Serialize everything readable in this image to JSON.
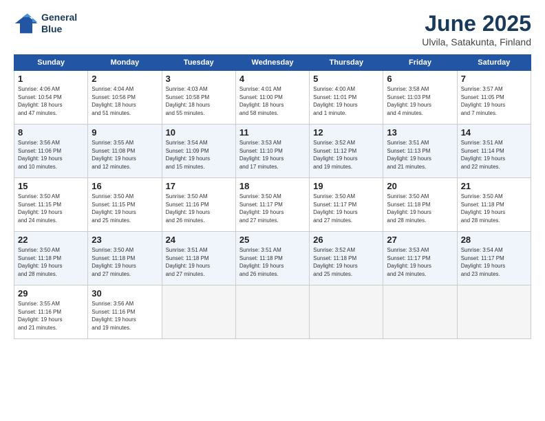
{
  "logo": {
    "line1": "General",
    "line2": "Blue"
  },
  "title": "June 2025",
  "subtitle": "Ulvila, Satakunta, Finland",
  "days_of_week": [
    "Sunday",
    "Monday",
    "Tuesday",
    "Wednesday",
    "Thursday",
    "Friday",
    "Saturday"
  ],
  "weeks": [
    [
      {
        "day": "1",
        "info": "Sunrise: 4:06 AM\nSunset: 10:54 PM\nDaylight: 18 hours\nand 47 minutes."
      },
      {
        "day": "2",
        "info": "Sunrise: 4:04 AM\nSunset: 10:56 PM\nDaylight: 18 hours\nand 51 minutes."
      },
      {
        "day": "3",
        "info": "Sunrise: 4:03 AM\nSunset: 10:58 PM\nDaylight: 18 hours\nand 55 minutes."
      },
      {
        "day": "4",
        "info": "Sunrise: 4:01 AM\nSunset: 11:00 PM\nDaylight: 18 hours\nand 58 minutes."
      },
      {
        "day": "5",
        "info": "Sunrise: 4:00 AM\nSunset: 11:01 PM\nDaylight: 19 hours\nand 1 minute."
      },
      {
        "day": "6",
        "info": "Sunrise: 3:58 AM\nSunset: 11:03 PM\nDaylight: 19 hours\nand 4 minutes."
      },
      {
        "day": "7",
        "info": "Sunrise: 3:57 AM\nSunset: 11:05 PM\nDaylight: 19 hours\nand 7 minutes."
      }
    ],
    [
      {
        "day": "8",
        "info": "Sunrise: 3:56 AM\nSunset: 11:06 PM\nDaylight: 19 hours\nand 10 minutes."
      },
      {
        "day": "9",
        "info": "Sunrise: 3:55 AM\nSunset: 11:08 PM\nDaylight: 19 hours\nand 12 minutes."
      },
      {
        "day": "10",
        "info": "Sunrise: 3:54 AM\nSunset: 11:09 PM\nDaylight: 19 hours\nand 15 minutes."
      },
      {
        "day": "11",
        "info": "Sunrise: 3:53 AM\nSunset: 11:10 PM\nDaylight: 19 hours\nand 17 minutes."
      },
      {
        "day": "12",
        "info": "Sunrise: 3:52 AM\nSunset: 11:12 PM\nDaylight: 19 hours\nand 19 minutes."
      },
      {
        "day": "13",
        "info": "Sunrise: 3:51 AM\nSunset: 11:13 PM\nDaylight: 19 hours\nand 21 minutes."
      },
      {
        "day": "14",
        "info": "Sunrise: 3:51 AM\nSunset: 11:14 PM\nDaylight: 19 hours\nand 22 minutes."
      }
    ],
    [
      {
        "day": "15",
        "info": "Sunrise: 3:50 AM\nSunset: 11:15 PM\nDaylight: 19 hours\nand 24 minutes."
      },
      {
        "day": "16",
        "info": "Sunrise: 3:50 AM\nSunset: 11:15 PM\nDaylight: 19 hours\nand 25 minutes."
      },
      {
        "day": "17",
        "info": "Sunrise: 3:50 AM\nSunset: 11:16 PM\nDaylight: 19 hours\nand 26 minutes."
      },
      {
        "day": "18",
        "info": "Sunrise: 3:50 AM\nSunset: 11:17 PM\nDaylight: 19 hours\nand 27 minutes."
      },
      {
        "day": "19",
        "info": "Sunrise: 3:50 AM\nSunset: 11:17 PM\nDaylight: 19 hours\nand 27 minutes."
      },
      {
        "day": "20",
        "info": "Sunrise: 3:50 AM\nSunset: 11:18 PM\nDaylight: 19 hours\nand 28 minutes."
      },
      {
        "day": "21",
        "info": "Sunrise: 3:50 AM\nSunset: 11:18 PM\nDaylight: 19 hours\nand 28 minutes."
      }
    ],
    [
      {
        "day": "22",
        "info": "Sunrise: 3:50 AM\nSunset: 11:18 PM\nDaylight: 19 hours\nand 28 minutes."
      },
      {
        "day": "23",
        "info": "Sunrise: 3:50 AM\nSunset: 11:18 PM\nDaylight: 19 hours\nand 27 minutes."
      },
      {
        "day": "24",
        "info": "Sunrise: 3:51 AM\nSunset: 11:18 PM\nDaylight: 19 hours\nand 27 minutes."
      },
      {
        "day": "25",
        "info": "Sunrise: 3:51 AM\nSunset: 11:18 PM\nDaylight: 19 hours\nand 26 minutes."
      },
      {
        "day": "26",
        "info": "Sunrise: 3:52 AM\nSunset: 11:18 PM\nDaylight: 19 hours\nand 25 minutes."
      },
      {
        "day": "27",
        "info": "Sunrise: 3:53 AM\nSunset: 11:17 PM\nDaylight: 19 hours\nand 24 minutes."
      },
      {
        "day": "28",
        "info": "Sunrise: 3:54 AM\nSunset: 11:17 PM\nDaylight: 19 hours\nand 23 minutes."
      }
    ],
    [
      {
        "day": "29",
        "info": "Sunrise: 3:55 AM\nSunset: 11:16 PM\nDaylight: 19 hours\nand 21 minutes."
      },
      {
        "day": "30",
        "info": "Sunrise: 3:56 AM\nSunset: 11:16 PM\nDaylight: 19 hours\nand 19 minutes."
      },
      {
        "day": "",
        "info": ""
      },
      {
        "day": "",
        "info": ""
      },
      {
        "day": "",
        "info": ""
      },
      {
        "day": "",
        "info": ""
      },
      {
        "day": "",
        "info": ""
      }
    ]
  ]
}
